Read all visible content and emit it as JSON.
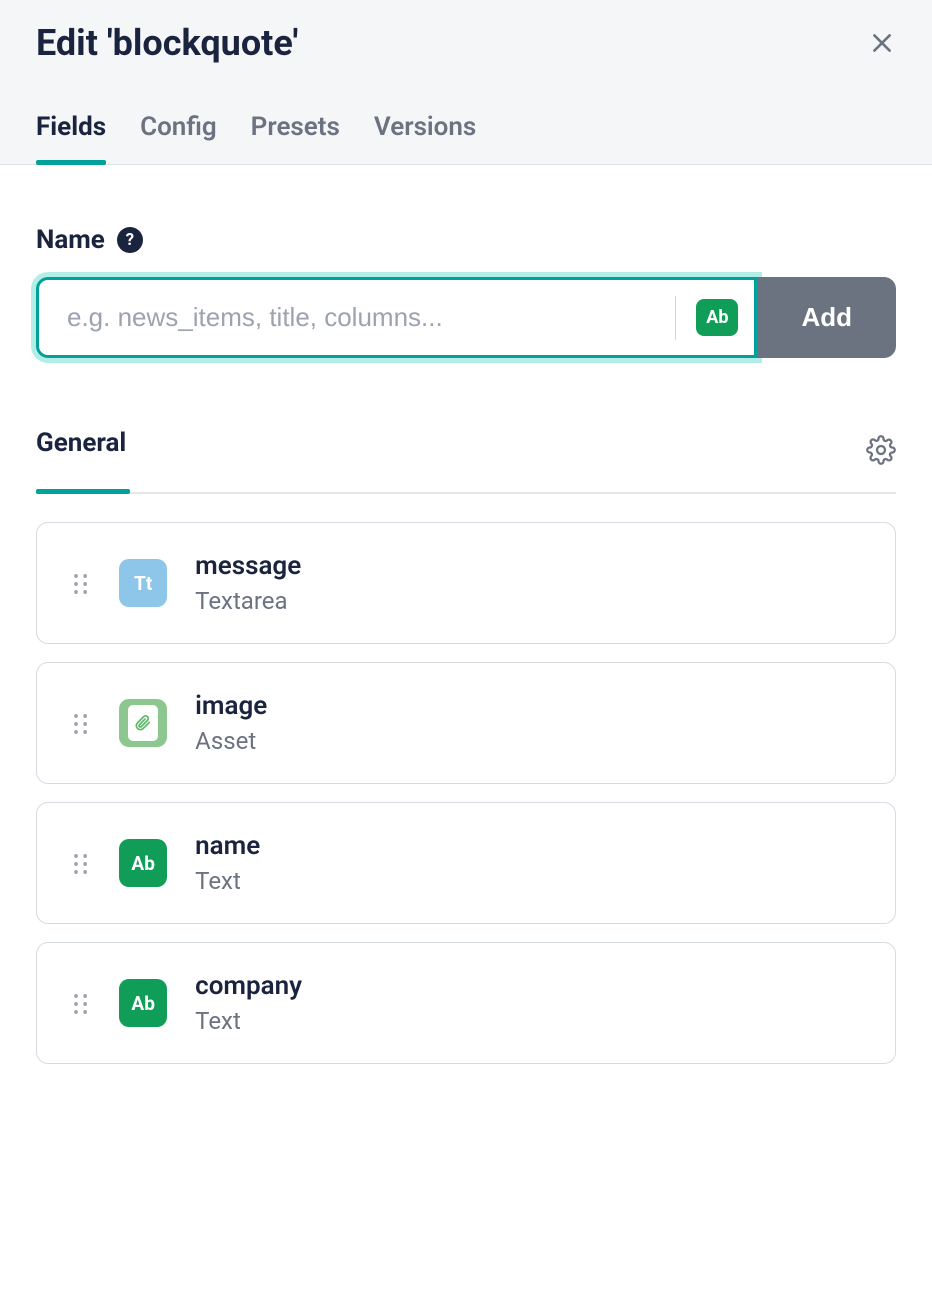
{
  "header": {
    "title": "Edit 'blockquote'"
  },
  "tabs": [
    {
      "label": "Fields",
      "active": true
    },
    {
      "label": "Config",
      "active": false
    },
    {
      "label": "Presets",
      "active": false
    },
    {
      "label": "Versions",
      "active": false
    }
  ],
  "nameField": {
    "label": "Name",
    "helpIcon": "?",
    "placeholder": "e.g. news_items, title, columns...",
    "value": "",
    "typeChip": "Ab",
    "addButton": "Add"
  },
  "section": {
    "label": "General"
  },
  "fields": [
    {
      "name": "message",
      "type": "Textarea",
      "iconKind": "textarea",
      "iconText": "Tt"
    },
    {
      "name": "image",
      "type": "Asset",
      "iconKind": "asset",
      "iconText": ""
    },
    {
      "name": "name",
      "type": "Text",
      "iconKind": "text",
      "iconText": "Ab"
    },
    {
      "name": "company",
      "type": "Text",
      "iconKind": "text",
      "iconText": "Ab"
    }
  ]
}
